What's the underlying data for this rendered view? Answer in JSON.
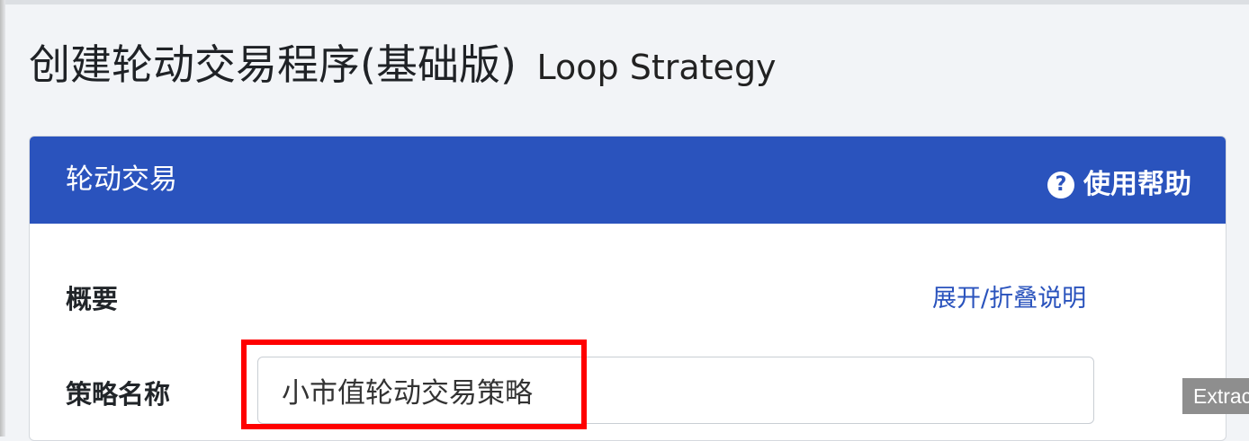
{
  "page": {
    "title": "创建轮动交易程序(基础版)",
    "subtitle": "Loop Strategy"
  },
  "card": {
    "header_title": "轮动交易",
    "help_icon": "question-circle-icon",
    "help_label": "使用帮助",
    "summary_label": "概要",
    "toggle_link": "展开/折叠说明",
    "strategy_name_label": "策略名称",
    "strategy_name_value": "小市值轮动交易策略"
  },
  "overlay": {
    "extract_tab": "Extract"
  },
  "colors": {
    "header_bg": "#2a53bd",
    "link": "#2a53bd",
    "highlight": "#ff0000"
  }
}
